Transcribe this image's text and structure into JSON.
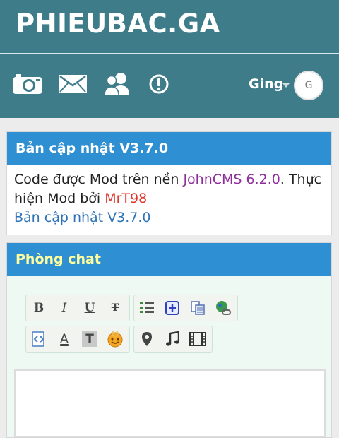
{
  "header": {
    "brand": "PHIEUBAC.GA",
    "username": "Ging",
    "avatar_letter": "G"
  },
  "nav": [
    {
      "name": "camera-icon"
    },
    {
      "name": "mail-icon"
    },
    {
      "name": "users-icon"
    },
    {
      "name": "alert-icon"
    }
  ],
  "update_panel": {
    "title": "Bản cập nhật V3.7.0",
    "text_before": "Code được Mod trên nền ",
    "cms": "JohnCMS 6.2.0",
    "text_middle": ". Thực hiện Mod bởi ",
    "author": "MrT98",
    "link": "Bản cập nhật V3.7.0"
  },
  "chat_panel": {
    "title": "Phòng chat"
  },
  "toolbar": {
    "bold": "B",
    "italic": "I",
    "underline": "U",
    "strike": "T",
    "text_color": "A",
    "text_bg": "T"
  },
  "colors": {
    "header": "#3d7c88",
    "panel_head": "#2e8fd2",
    "chat_title": "#ffff9e",
    "author": "#e0362c",
    "cms": "#8e2e9b"
  }
}
